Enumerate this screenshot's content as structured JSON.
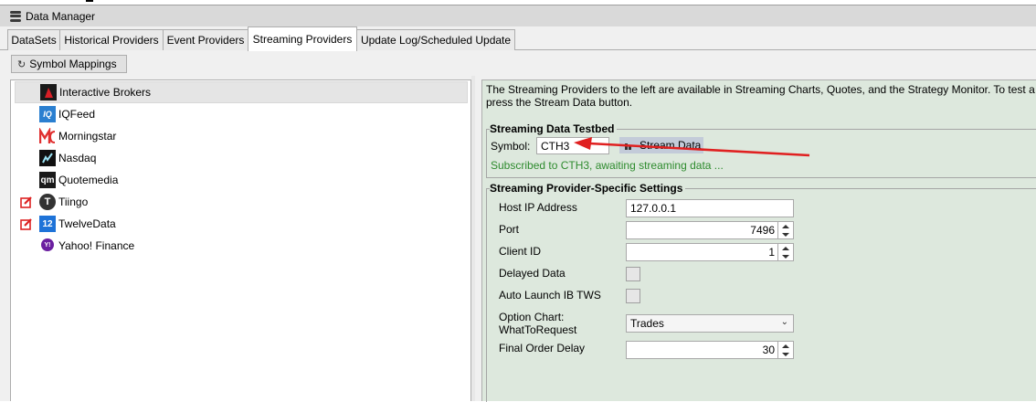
{
  "window": {
    "title": "Data Manager",
    "icon": "database-icon"
  },
  "tabs": [
    {
      "label": "DataSets",
      "active": false
    },
    {
      "label": "Historical Providers",
      "active": false
    },
    {
      "label": "Event Providers",
      "active": false
    },
    {
      "label": "Streaming Providers",
      "active": true
    },
    {
      "label": "Update Log/Scheduled Update",
      "active": false
    }
  ],
  "toolbar": {
    "symbol_mappings_label": "Symbol Mappings"
  },
  "providers": [
    {
      "name": "Interactive Brokers",
      "logo": "interactive-brokers-logo",
      "selected": true,
      "editable": false
    },
    {
      "name": "IQFeed",
      "logo": "iqfeed-logo",
      "selected": false,
      "editable": false
    },
    {
      "name": "Morningstar",
      "logo": "morningstar-logo",
      "selected": false,
      "editable": false
    },
    {
      "name": "Nasdaq",
      "logo": "nasdaq-logo",
      "selected": false,
      "editable": false
    },
    {
      "name": "Quotemedia",
      "logo": "quotemedia-logo",
      "selected": false,
      "editable": false
    },
    {
      "name": "Tiingo",
      "logo": "tiingo-logo",
      "selected": false,
      "editable": true
    },
    {
      "name": "TwelveData",
      "logo": "twelvedata-logo",
      "selected": false,
      "editable": true
    },
    {
      "name": "Yahoo! Finance",
      "logo": "yahoo-finance-logo",
      "selected": false,
      "editable": false
    }
  ],
  "logo_text": {
    "iqfeed": "IQ",
    "twelvedata": "12",
    "quotemedia": "qm",
    "yahoo": "Y!"
  },
  "description": {
    "line1": "The Streaming Providers to the left are available in Streaming Charts, Quotes, and the Strategy Monitor. To test a Str",
    "line2": "press the Stream Data button."
  },
  "testbed": {
    "title": "Streaming Data Testbed",
    "symbol_label": "Symbol:",
    "symbol_value": "CTH3",
    "stream_button_label": "Stream Data",
    "status": "Subscribed to CTH3, awaiting streaming data ...",
    "status_color": "#2e8b2e"
  },
  "settings": {
    "title": "Streaming Provider-Specific Settings",
    "host_ip_label": "Host IP Address",
    "host_ip_value": "127.0.0.1",
    "port_label": "Port",
    "port_value": "7496",
    "client_id_label": "Client ID",
    "client_id_value": "1",
    "delayed_data_label": "Delayed Data",
    "delayed_data_checked": false,
    "auto_launch_label": "Auto Launch IB TWS",
    "auto_launch_checked": false,
    "option_chart_label_line1": "Option Chart:",
    "option_chart_label_line2": "WhatToRequest",
    "option_chart_value": "Trades",
    "final_order_delay_label": "Final Order Delay",
    "final_order_delay_value": "30"
  },
  "annotation": {
    "arrow_color": "#e02020"
  }
}
